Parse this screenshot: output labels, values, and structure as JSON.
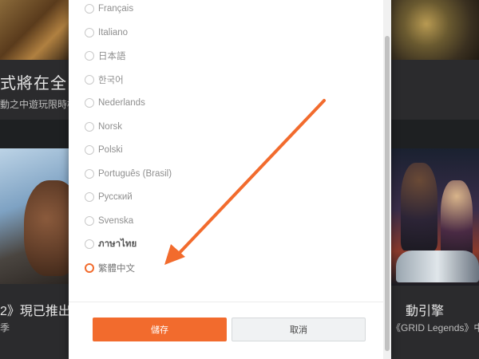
{
  "background": {
    "card_top_left": {
      "title": "式將在全",
      "subtitle": "動之中遊玩限時模"
    },
    "card_bottom_left": {
      "title": "2》現已推出",
      "subtitle": "季"
    },
    "card_bottom_right": {
      "title": "動引擎",
      "subtitle": "《GRID Legends》中製"
    }
  },
  "language_dialog": {
    "options": [
      {
        "label": "Français",
        "selected": false
      },
      {
        "label": "Italiano",
        "selected": false
      },
      {
        "label": "日本語",
        "selected": false
      },
      {
        "label": "한국어",
        "selected": false
      },
      {
        "label": "Nederlands",
        "selected": false
      },
      {
        "label": "Norsk",
        "selected": false
      },
      {
        "label": "Polski",
        "selected": false
      },
      {
        "label": "Português (Brasil)",
        "selected": false
      },
      {
        "label": "Русский",
        "selected": false
      },
      {
        "label": "Svenska",
        "selected": false
      },
      {
        "label": "ภาษาไทย",
        "selected": false
      },
      {
        "label": "繁體中文",
        "selected": true
      }
    ],
    "save_label": "儲存",
    "cancel_label": "取消"
  },
  "colors": {
    "accent": "#f26b2d",
    "arrow": "#f26b2d",
    "overlay": "#1e2022"
  },
  "icons": {
    "annotation": "arrow-icon"
  }
}
